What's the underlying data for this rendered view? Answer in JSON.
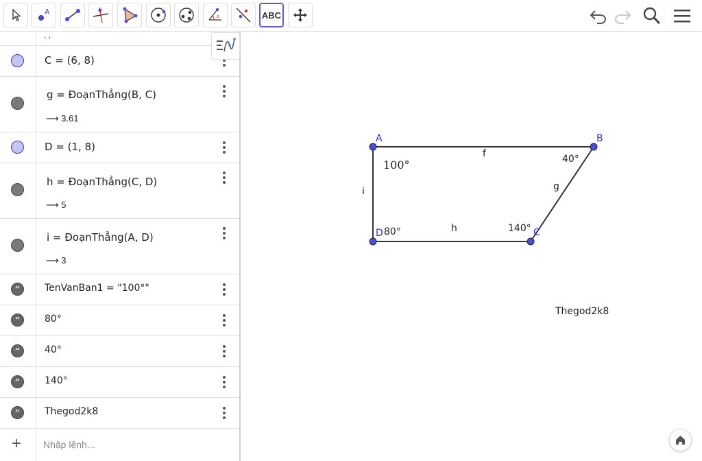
{
  "toolbar": {
    "tools": [
      {
        "name": "move-tool",
        "icon": "arrow-pointer-icon"
      },
      {
        "name": "point-tool",
        "icon": "point-icon",
        "label": "A"
      },
      {
        "name": "segment-tool",
        "icon": "segment-icon"
      },
      {
        "name": "perpendicular-tool",
        "icon": "perpendicular-icon"
      },
      {
        "name": "polygon-tool",
        "icon": "polygon-icon"
      },
      {
        "name": "circle-tool",
        "icon": "circle-center-icon"
      },
      {
        "name": "circle-three-points-tool",
        "icon": "circle-three-points-icon"
      },
      {
        "name": "angle-tool",
        "icon": "angle-icon"
      },
      {
        "name": "reflect-tool",
        "icon": "reflect-line-icon"
      },
      {
        "name": "text-tool",
        "label": "ABC",
        "active": true
      },
      {
        "name": "move-view-tool",
        "icon": "move-arrows-icon"
      }
    ],
    "undo_icon": "undo-icon",
    "redo_icon": "redo-icon",
    "search_icon": "search-icon",
    "menu_icon": "hamburger-menu-icon"
  },
  "algebra": {
    "rows": [
      {
        "kind": "pt",
        "def": "C = (6, 8)"
      },
      {
        "kind": "seg",
        "def": "g = ĐoạnThẳng(B, C)",
        "value": "3.61"
      },
      {
        "kind": "pt",
        "def": "D = (1, 8)"
      },
      {
        "kind": "seg",
        "def": "h = ĐoạnThẳng(C, D)",
        "value": "5"
      },
      {
        "kind": "seg",
        "def": "i = ĐoạnThẳng(A, D)",
        "value": "3"
      },
      {
        "kind": "txt",
        "def": "TenVanBan1 = \"100°\""
      },
      {
        "kind": "txt",
        "def": "80°"
      },
      {
        "kind": "txt",
        "def": "40°"
      },
      {
        "kind": "txt",
        "def": "140°"
      },
      {
        "kind": "txt",
        "def": "Thegod2k8"
      }
    ],
    "arrow": "⟶",
    "input_placeholder": "Nhập lệnh..."
  },
  "graphics": {
    "points": {
      "A": "A",
      "B": "B",
      "C": "C",
      "D": "D"
    },
    "segments": {
      "f": "f",
      "g": "g",
      "h": "h",
      "i": "i"
    },
    "texts": {
      "t100": "100°",
      "t80": "80°",
      "t40": "40°",
      "t140": "140°",
      "author": "Thegod2k8"
    },
    "colors": {
      "point": "#4d4de6",
      "segment": "#333333",
      "label": "#3333cc"
    }
  }
}
